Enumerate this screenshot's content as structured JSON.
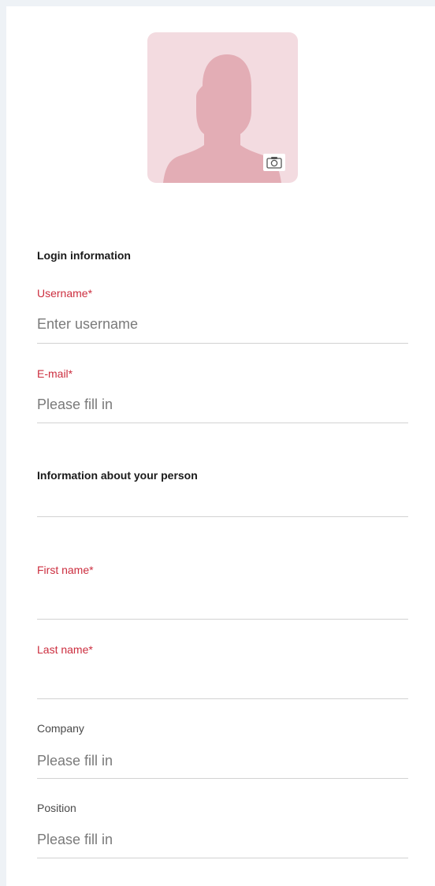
{
  "avatar": {
    "icon": "person-silhouette-icon",
    "camera_icon": "camera-icon",
    "colors": {
      "background": "#f3dbe0",
      "silhouette": "#e3adb5"
    }
  },
  "login_section": {
    "title": "Login information",
    "username": {
      "label": "Username*",
      "placeholder": "Enter username"
    },
    "email": {
      "label": "E-mail*",
      "placeholder": "Please fill in"
    }
  },
  "person_section": {
    "title": "Information about your person",
    "first_name": {
      "label": "First name*"
    },
    "last_name": {
      "label": "Last name*"
    },
    "company": {
      "label": "Company",
      "placeholder": "Please fill in"
    },
    "position": {
      "label": "Position",
      "placeholder": "Please fill in"
    }
  },
  "colors": {
    "required_label": "#cc2e3f",
    "optional_label": "#4a4a4a",
    "placeholder": "#7a7a7a",
    "underline": "#d2d2d2",
    "page_background": "#eef2f6"
  }
}
